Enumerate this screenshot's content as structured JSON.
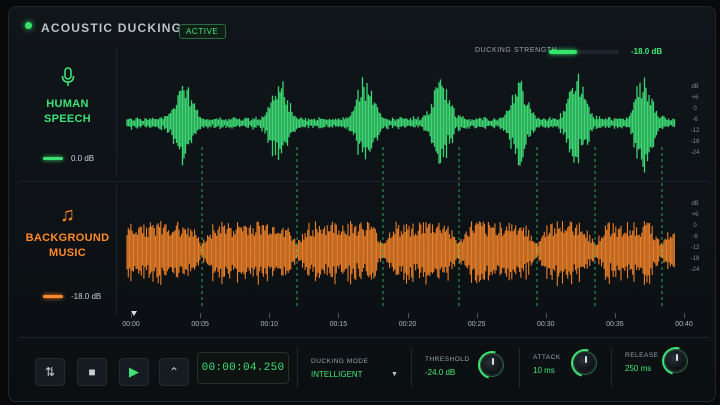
{
  "header": {
    "title": "ACOUSTIC DUCKING",
    "status_badge": "ACTIVE",
    "ducking_strength_label": "DUCKING STRENGTH",
    "ducking_strength_value": "-18.0 dB",
    "ducking_strength_fraction": 0.4
  },
  "tracks": [
    {
      "name_line1": "HUMAN",
      "name_line2": "SPEECH",
      "icon": "microphone-icon",
      "level": "0.0 dB",
      "color": "#3fe177"
    },
    {
      "name_line1": "BACKGROUND",
      "name_line2": "MUSIC",
      "icon": "music-note-icon",
      "level": "-18.0 dB",
      "color": "#ff8a2a"
    }
  ],
  "db_scale": [
    "dB",
    "+6",
    "0",
    "-6",
    "-12",
    "-18",
    "-24"
  ],
  "timeline": [
    "00:00",
    "00:05",
    "00:10",
    "00:15",
    "00:20",
    "00:25",
    "00:30",
    "00:35",
    "00:40"
  ],
  "transport": {
    "timecode": "00:00:04.250",
    "ducking_mode_label": "DUCKING MODE",
    "ducking_mode_value": "INTELLIGENT",
    "threshold_label": "THRESHOLD",
    "threshold_value": "-24.0 dB",
    "attack_label": "ATTACK",
    "attack_value": "10 ms",
    "release_label": "RELEASE",
    "release_value": "250 ms"
  },
  "colors": {
    "accent": "#3fe177",
    "music": "#ff8a2a",
    "background": "#0b0f12"
  }
}
